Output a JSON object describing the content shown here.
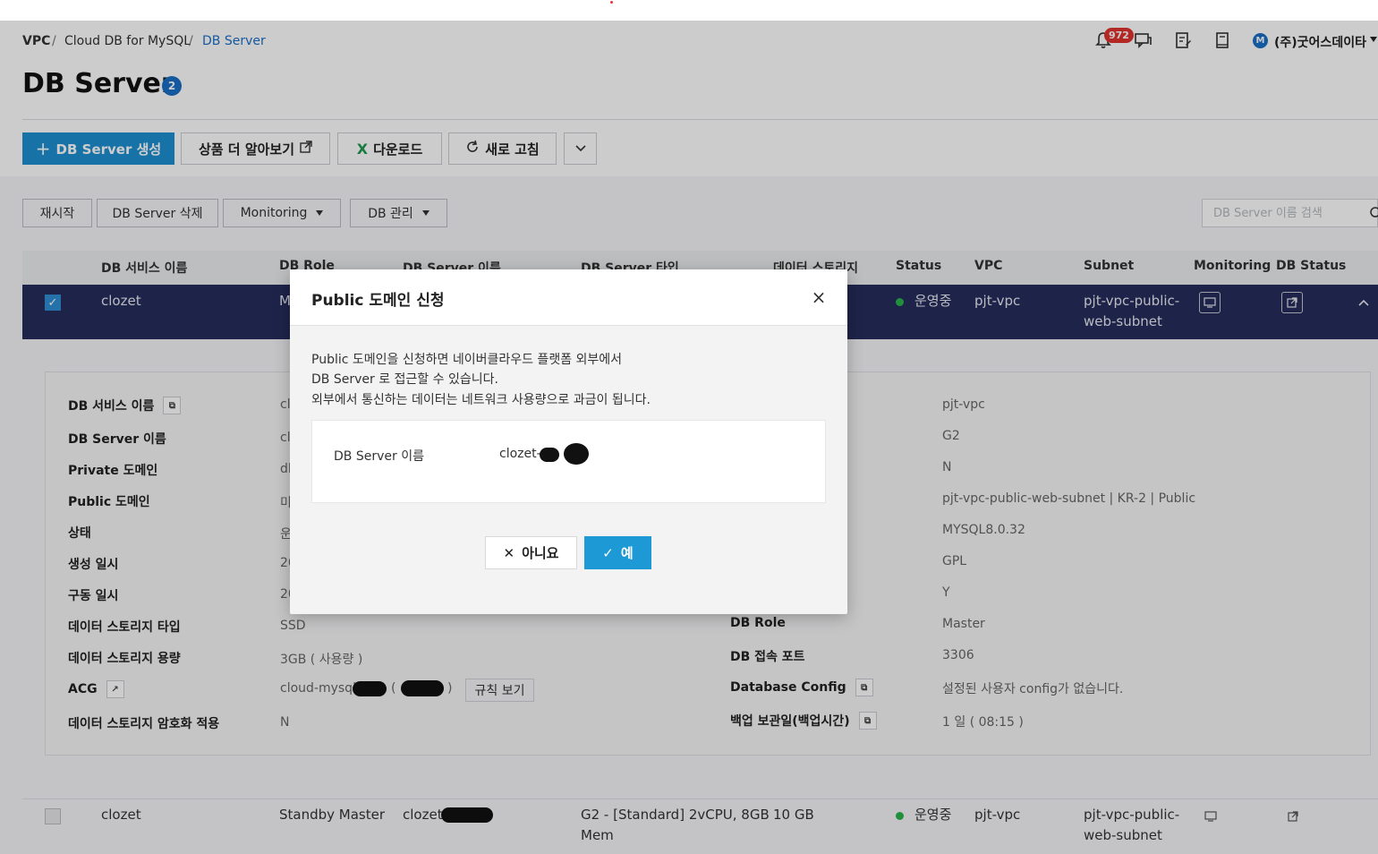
{
  "breadcrumb": {
    "vpc": "VPC",
    "sep1": "/",
    "service": "Cloud DB for MySQL",
    "sep2": "/",
    "current": "DB Server"
  },
  "header": {
    "title": "DB Server",
    "count": "2",
    "notification_count": "972",
    "account": "(주)굿어스데이타",
    "account_avatar": "M"
  },
  "toolbar": {
    "create_plus": "+",
    "create": "DB Server 생성",
    "learn_more": "상품 더 알아보기",
    "download_icon": "X",
    "download": "다운로드",
    "refresh": "새로 고침"
  },
  "actions": {
    "restart": "재시작",
    "delete": "DB Server 삭제",
    "monitoring": "Monitoring",
    "db_manage": "DB 관리",
    "search_placeholder": "DB Server 이름 검색"
  },
  "table": {
    "headers": [
      "DB 서비스 이름",
      "DB Role",
      "DB Server 이름",
      "DB Server 타입",
      "데이터 스토리지",
      "Status",
      "VPC",
      "Subnet",
      "Monitoring",
      "DB Status"
    ],
    "row1": {
      "service": "clozet",
      "role_partial": "M",
      "status": "운영중",
      "vpc": "pjt-vpc",
      "subnet_line1": "pjt-vpc-public-",
      "subnet_line2": "web-subnet"
    },
    "row2": {
      "service": "clozet",
      "role": "Standby Master",
      "server_prefix": "clozet-",
      "type_line1": "G2 - [Standard] 2vCPU, 8GB",
      "type_line2": "Mem",
      "storage": "10 GB",
      "status": "운영중",
      "vpc": "pjt-vpc",
      "subnet_line1": "pjt-vpc-public-",
      "subnet_line2": "web-subnet"
    }
  },
  "detail": {
    "left": [
      {
        "label": "DB 서비스 이름",
        "value": "cl"
      },
      {
        "label": "DB Server 이름",
        "value": "cl"
      },
      {
        "label": "Private 도메인",
        "value": "dl"
      },
      {
        "label": "Public 도메인",
        "value": "미"
      },
      {
        "label": "상태",
        "value": "운"
      },
      {
        "label": "생성 일시",
        "value": "20"
      },
      {
        "label": "구동 일시",
        "value": "20"
      },
      {
        "label": "데이터 스토리지 타입",
        "value": "SSD"
      },
      {
        "label": "데이터 스토리지 용량",
        "value": "3GB ( 사용량 )"
      },
      {
        "label": "ACG",
        "value": "cloud-mysql"
      },
      {
        "label": "데이터 스토리지 암호화 적용",
        "value": "N"
      }
    ],
    "acg_paren_open": "(",
    "acg_paren_close": ")",
    "rule_button": "규칙 보기",
    "right_values": [
      "pjt-vpc",
      "G2",
      "N",
      "pjt-vpc-public-web-subnet | KR-2 | Public",
      "MYSQL8.0.32",
      "GPL",
      "Y"
    ],
    "right_labeled": [
      {
        "label": "DB Role",
        "value": "Master"
      },
      {
        "label": "DB 접속 포트",
        "value": "3306"
      },
      {
        "label": "Database Config",
        "value": "설정된 사용자 config가 없습니다."
      },
      {
        "label": "백업 보관일(백업시간)",
        "value": "1 일 ( 08:15 )"
      }
    ]
  },
  "modal": {
    "title": "Public 도메인 신청",
    "close": "×",
    "desc1": "Public 도메인을 신청하면 네이버클라우드 플랫폼 외부에서",
    "desc2": "DB Server 로 접근할 수 있습니다.",
    "desc3": "외부에서 통신하는 데이터는 네트워크 사용량으로 과금이 됩니다.",
    "field_label": "DB Server 이름",
    "field_value": "clozet-",
    "no_icon": "✕",
    "no": "아니요",
    "yes_icon": "✓",
    "yes": "예"
  },
  "icons": {
    "bell": "bell-icon",
    "chat": "chat-icon",
    "memo": "memo-icon",
    "book": "book-icon",
    "external": "external-link-icon",
    "refresh": "refresh-icon",
    "chevron": "chevron-down-icon",
    "caret": "caret-down-icon",
    "copy": "copy-icon",
    "monitor": "monitor-icon",
    "collapse": "chevron-up-icon"
  },
  "colors": {
    "primary": "#1d8fd1",
    "link": "#1a6fc7",
    "selected_row": "#262c5c",
    "badge": "#e0322f",
    "status_ok": "#2bb34a"
  }
}
